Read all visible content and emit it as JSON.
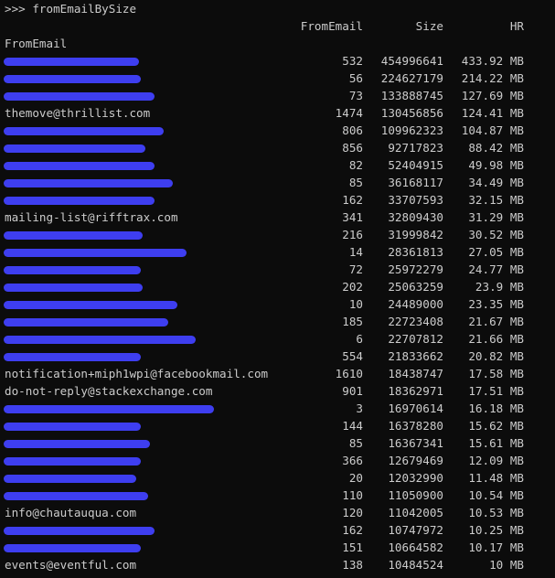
{
  "prompt": ">>> fromEmailBySize",
  "headers": {
    "from_email": "FromEmail",
    "size": "Size",
    "hr": "HR"
  },
  "index_label": "FromEmail",
  "redaction_color": "#3e3ef0",
  "rows": [
    {
      "email": "",
      "redacted": true,
      "from": "532",
      "size": "454996641",
      "hr": "433.92 MB"
    },
    {
      "email": "",
      "redacted": true,
      "from": "56",
      "size": "224627179",
      "hr": "214.22 MB"
    },
    {
      "email": "",
      "redacted": true,
      "from": "73",
      "size": "133888745",
      "hr": "127.69 MB"
    },
    {
      "email": "themove@thrillist.com",
      "redacted": false,
      "from": "1474",
      "size": "130456856",
      "hr": "124.41 MB"
    },
    {
      "email": "",
      "redacted": true,
      "from": "806",
      "size": "109962323",
      "hr": "104.87 MB"
    },
    {
      "email": "",
      "redacted": true,
      "from": "856",
      "size": "92717823",
      "hr": "88.42 MB"
    },
    {
      "email": "",
      "redacted": true,
      "from": "82",
      "size": "52404915",
      "hr": "49.98 MB"
    },
    {
      "email": "",
      "redacted": true,
      "from": "85",
      "size": "36168117",
      "hr": "34.49 MB"
    },
    {
      "email": "",
      "redacted": true,
      "from": "162",
      "size": "33707593",
      "hr": "32.15 MB"
    },
    {
      "email": "mailing-list@rifftrax.com",
      "redacted": false,
      "from": "341",
      "size": "32809430",
      "hr": "31.29 MB"
    },
    {
      "email": "",
      "redacted": true,
      "from": "216",
      "size": "31999842",
      "hr": "30.52 MB"
    },
    {
      "email": "",
      "redacted": true,
      "from": "14",
      "size": "28361813",
      "hr": "27.05 MB"
    },
    {
      "email": "",
      "redacted": true,
      "from": "72",
      "size": "25972279",
      "hr": "24.77 MB"
    },
    {
      "email": "",
      "redacted": true,
      "from": "202",
      "size": "25063259",
      "hr": "23.9 MB"
    },
    {
      "email": "",
      "redacted": true,
      "from": "10",
      "size": "24489000",
      "hr": "23.35 MB"
    },
    {
      "email": "",
      "redacted": true,
      "from": "185",
      "size": "22723408",
      "hr": "21.67 MB"
    },
    {
      "email": "",
      "redacted": true,
      "from": "6",
      "size": "22707812",
      "hr": "21.66 MB"
    },
    {
      "email": "",
      "redacted": true,
      "from": "554",
      "size": "21833662",
      "hr": "20.82 MB"
    },
    {
      "email": "notification+miph1wpi@facebookmail.com",
      "redacted": false,
      "from": "1610",
      "size": "18438747",
      "hr": "17.58 MB"
    },
    {
      "email": "do-not-reply@stackexchange.com",
      "redacted": false,
      "from": "901",
      "size": "18362971",
      "hr": "17.51 MB"
    },
    {
      "email": "",
      "redacted": true,
      "from": "3",
      "size": "16970614",
      "hr": "16.18 MB"
    },
    {
      "email": "",
      "redacted": true,
      "from": "144",
      "size": "16378280",
      "hr": "15.62 MB"
    },
    {
      "email": "",
      "redacted": true,
      "from": "85",
      "size": "16367341",
      "hr": "15.61 MB"
    },
    {
      "email": "",
      "redacted": true,
      "from": "366",
      "size": "12679469",
      "hr": "12.09 MB"
    },
    {
      "email": "",
      "redacted": true,
      "from": "20",
      "size": "12032990",
      "hr": "11.48 MB"
    },
    {
      "email": "",
      "redacted": true,
      "from": "110",
      "size": "11050900",
      "hr": "10.54 MB"
    },
    {
      "email": "info@chautauqua.com",
      "redacted": false,
      "from": "120",
      "size": "11042005",
      "hr": "10.53 MB"
    },
    {
      "email": "",
      "redacted": true,
      "from": "162",
      "size": "10747972",
      "hr": "10.25 MB"
    },
    {
      "email": "",
      "redacted": true,
      "from": "151",
      "size": "10664582",
      "hr": "10.17 MB"
    },
    {
      "email": "events@eventful.com",
      "redacted": false,
      "from": "138",
      "size": "10484524",
      "hr": "10 MB"
    }
  ]
}
